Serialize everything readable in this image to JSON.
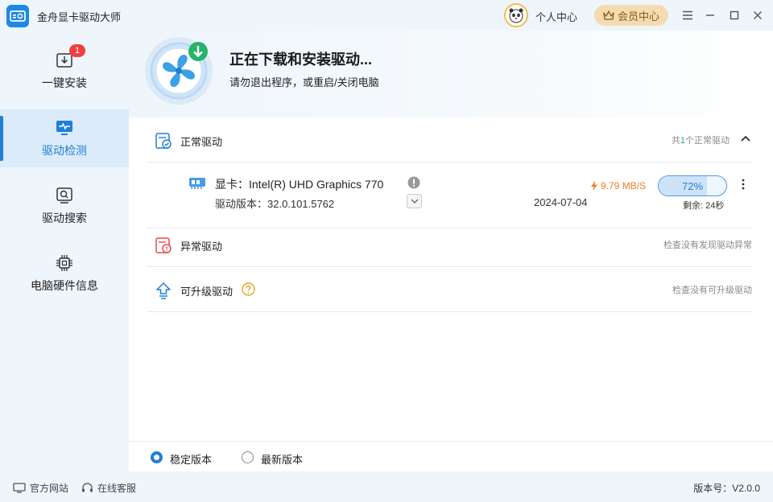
{
  "app": {
    "title": "金舟显卡驱动大师"
  },
  "header": {
    "user_center": "个人中心",
    "vip_label": "会员中心"
  },
  "sidebar": {
    "items": [
      {
        "label": "一键安装",
        "badge": "1"
      },
      {
        "label": "驱动检测"
      },
      {
        "label": "驱动搜索"
      },
      {
        "label": "电脑硬件信息"
      }
    ]
  },
  "banner": {
    "title": "正在下载和安装驱动...",
    "subtitle": "请勿退出程序，或重启/关闭电脑"
  },
  "sections": {
    "normal": {
      "title": "正常驱动",
      "summary_prefix": "共",
      "summary_count": "1",
      "summary_suffix": "个正常驱动"
    },
    "abnormal": {
      "title": "异常驱动",
      "summary": "检查没有发现驱动异常"
    },
    "upgradable": {
      "title": "可升级驱动",
      "summary": "检查没有可升级驱动"
    }
  },
  "driver": {
    "name": "显卡：Intel(R) UHD Graphics 770",
    "version": "驱动版本：32.0.101.5762",
    "date": "2024-07-04",
    "speed": "9.79 MB/S",
    "progress_label": "72%",
    "progress": 0.72,
    "remaining": "剩余: 24秒"
  },
  "versions": {
    "stable": "稳定版本",
    "latest": "最新版本",
    "selected": "stable"
  },
  "footer": {
    "website": "官方网站",
    "support": "在线客服",
    "version": "版本号：V2.0.0"
  },
  "colors": {
    "accent": "#1e7ed8",
    "badge": "#f04040",
    "speed": "#f08020",
    "vip_bg": "#f5dcb0"
  }
}
